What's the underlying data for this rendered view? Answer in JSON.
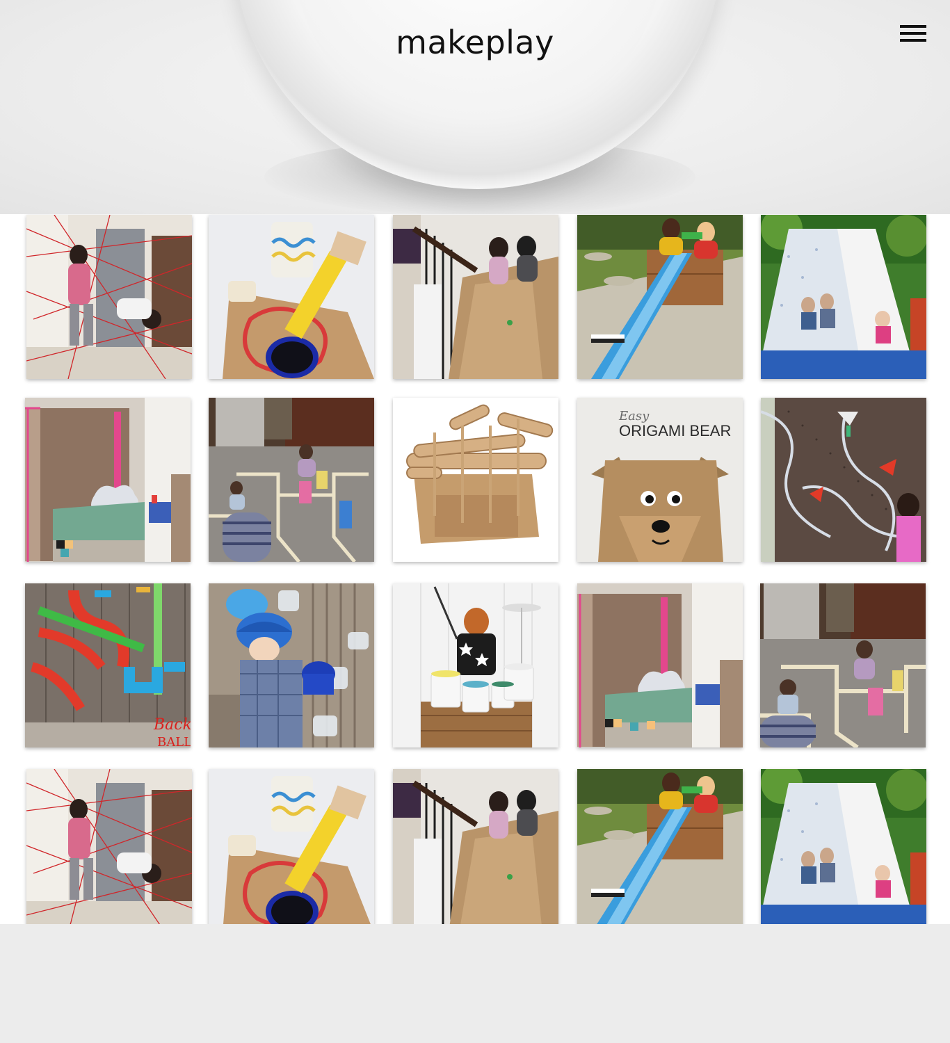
{
  "site": {
    "logo_text": "makeplay"
  },
  "header": {
    "menu_icon": "hamburger-menu-icon"
  },
  "gallery": {
    "rows": [
      [
        "string-laser-maze",
        "cardboard-box-guitar",
        "stair-cardboard-slide",
        "blue-ramp-race-track",
        "backyard-sheet-tent"
      ],
      [
        "cardboard-reading-nook",
        "tape-road-playmat",
        "cardboard-tube-marble-run",
        "origami-bear",
        "pegboard-water-wall"
      ],
      [
        "pipe-ball-run-fence",
        "hanging-bottle-water-wall",
        "paint-can-drum-kit",
        "cardboard-reading-nook",
        "tape-road-playmat"
      ],
      [
        "string-laser-maze",
        "cardboard-box-guitar",
        "stair-cardboard-slide",
        "blue-ramp-race-track",
        "backyard-sheet-tent"
      ]
    ],
    "origami_bear_text": {
      "line1": "Easy",
      "line2": "ORIGAMI BEAR"
    },
    "ball_run_text": "Back BALL"
  },
  "colors": {
    "header_bg": "#ebebeb",
    "footer_bg": "#ececec"
  }
}
